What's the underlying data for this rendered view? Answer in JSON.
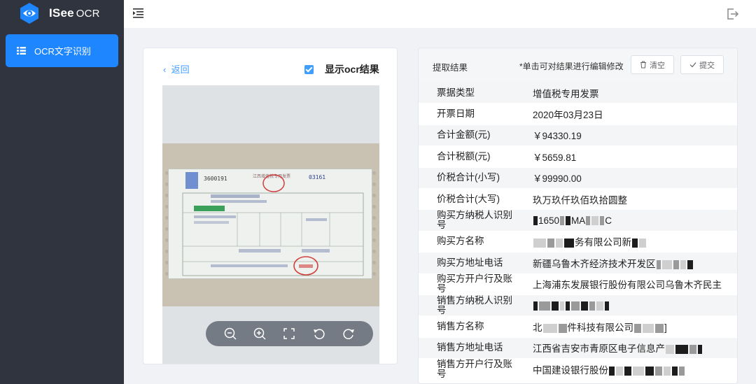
{
  "app": {
    "name": "ISee",
    "name_suffix": "OCR"
  },
  "sidebar": {
    "items": [
      {
        "label": "OCR文字识别",
        "icon": "grid-icon",
        "active": true
      }
    ]
  },
  "topbar": {
    "menu_icon": "menu-fold-icon",
    "exit_icon": "logout-icon"
  },
  "left_panel": {
    "back_label": "返回",
    "show_ocr_label": "显示ocr结果",
    "show_ocr_checked": true,
    "toolbar_icons": [
      "zoom-out-icon",
      "zoom-in-icon",
      "fullscreen-icon",
      "rotate-left-icon",
      "rotate-right-icon"
    ]
  },
  "right_panel": {
    "title": "提取结果",
    "hint": "*单击可对结果进行编辑修改",
    "clear_label": "清空",
    "submit_label": "提交",
    "rows": [
      {
        "key": "票据类型",
        "value": "增值税专用发票"
      },
      {
        "key": "开票日期",
        "value": "2020年03月23日"
      },
      {
        "key": "合计金额(元)",
        "value": "￥94330.19"
      },
      {
        "key": "合计税额(元)",
        "value": "￥5659.81"
      },
      {
        "key": "价税合计(小写)",
        "value": "￥99990.00"
      },
      {
        "key": "价税合计(大写)",
        "value": "玖万玖仟玖佰玖拾圆整"
      },
      {
        "key": "购买方纳税人识别号",
        "value_parts": [
          "1650",
          "MA",
          "C"
        ]
      },
      {
        "key": "购买方名称",
        "value_parts": [
          "务有限公司新"
        ]
      },
      {
        "key": "购买方地址电话",
        "value_parts": [
          "新疆乌鲁木齐经济技术开发区"
        ]
      },
      {
        "key": "购买方开户行及账号",
        "value": "上海浦东发展银行股份有限公司乌鲁木齐民主"
      },
      {
        "key": "销售方纳税人识别号",
        "value_parts": []
      },
      {
        "key": "销售方名称",
        "value_parts": [
          "北",
          "件科技有限公司",
          "]"
        ]
      },
      {
        "key": "销售方地址电话",
        "value_parts": [
          "江西省吉安市青原区电子信息产"
        ]
      },
      {
        "key": "销售方开户行及账号",
        "value_parts": [
          "中国建设银行股份"
        ]
      }
    ]
  },
  "invoice_image": {
    "invoice_no_left": "3600191",
    "invoice_no_right": "03161",
    "header_text": "江西增值税专用发票"
  },
  "colors": {
    "sidebar_bg": "#30343f",
    "accent": "#1e86ff",
    "toolbar_bg": "#747b85"
  }
}
